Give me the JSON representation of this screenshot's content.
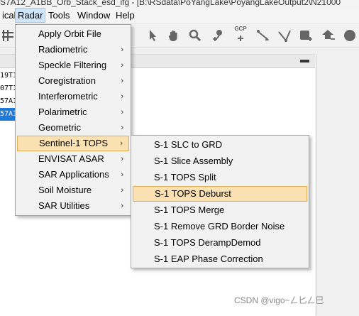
{
  "window": {
    "title": "S7A12_A1BB_Orb_Stack_esd_ifg - [B:\\RSdata\\PoYangLake\\PoyangLakeOutput2\\N21000"
  },
  "menubar": {
    "items": [
      "ical",
      "Radar",
      "Tools",
      "Window",
      "Help"
    ],
    "active": "Radar"
  },
  "toolbar": {
    "gcp_label": "GCP",
    "icons": [
      "grid-icon",
      "select-arrow-icon",
      "pan-hand-icon",
      "zoom-icon",
      "pin-add-icon",
      "gcp-add-icon",
      "range-finder-icon",
      "measure-angle-icon",
      "add-shape-icon",
      "pin-manager-icon",
      "world-map-icon"
    ]
  },
  "product_tree": {
    "rows": [
      "19T1",
      "07T1",
      "57A1",
      "57A1"
    ],
    "selected_index": 3
  },
  "radar_menu": {
    "items": [
      {
        "label": "Apply Orbit File",
        "submenu": false
      },
      {
        "label": "Radiometric",
        "submenu": true
      },
      {
        "label": "Speckle Filtering",
        "submenu": true
      },
      {
        "label": "Coregistration",
        "submenu": true
      },
      {
        "label": "Interferometric",
        "submenu": true
      },
      {
        "label": "Polarimetric",
        "submenu": true
      },
      {
        "label": "Geometric",
        "submenu": true
      },
      {
        "label": "Sentinel-1 TOPS",
        "submenu": true
      },
      {
        "label": "ENVISAT ASAR",
        "submenu": true
      },
      {
        "label": "SAR Applications",
        "submenu": true
      },
      {
        "label": "Soil Moisture",
        "submenu": true
      },
      {
        "label": "SAR Utilities",
        "submenu": true
      }
    ],
    "active_index": 7,
    "arrow_glyph": "›"
  },
  "tops_submenu": {
    "items": [
      "S-1 SLC to GRD",
      "S-1 Slice Assembly",
      "S-1 TOPS Split",
      "S-1 TOPS Deburst",
      "S-1 TOPS Merge",
      "S-1 Remove GRD Border Noise",
      "S-1 TOPS DerampDemod",
      "S-1 EAP Phase Correction"
    ],
    "active_index": 3
  },
  "watermark": "CSDN @vigo~ㄥ匕ㄥ巳",
  "colors": {
    "menu_highlight": "#cfe5fa",
    "item_highlight": "#fbe1b1",
    "item_highlight_border": "#e0ad53",
    "tree_selection": "#1e78d7"
  }
}
